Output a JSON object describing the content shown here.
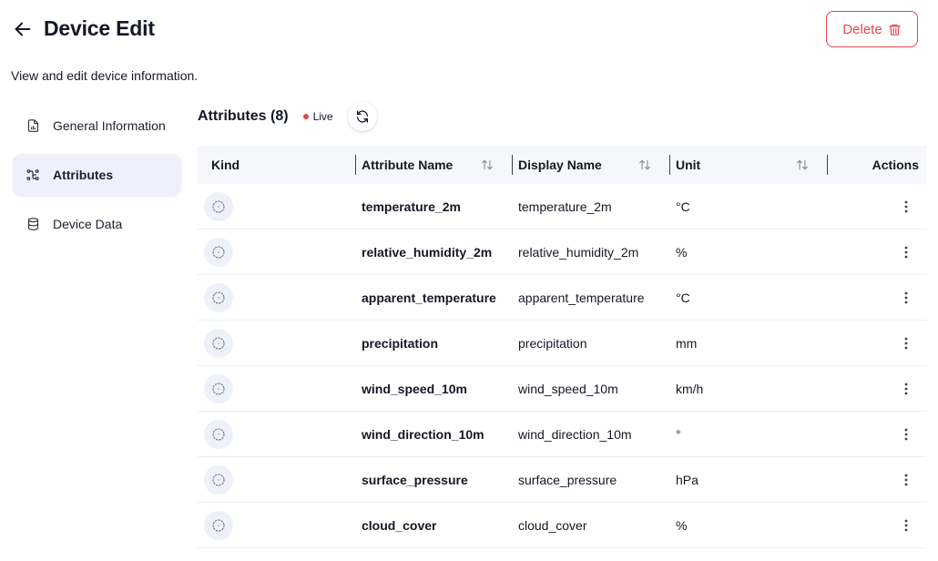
{
  "page": {
    "title": "Device Edit",
    "subtitle": "View and edit device information.",
    "delete_label": "Delete"
  },
  "colors": {
    "danger": "#e5484d",
    "active_nav_bg": "#eff0fb",
    "header_bg": "#f6f7fb"
  },
  "sidebar": {
    "items": [
      {
        "label": "General Information",
        "icon": "file-chart-icon",
        "active": false
      },
      {
        "label": "Attributes",
        "icon": "nodes-icon",
        "active": true
      },
      {
        "label": "Device Data",
        "icon": "database-icon",
        "active": false
      }
    ]
  },
  "section": {
    "title": "Attributes (8)",
    "live_label": "Live"
  },
  "table": {
    "headers": {
      "kind": "Kind",
      "attribute_name": "Attribute Name",
      "display_name": "Display Name",
      "unit": "Unit",
      "actions": "Actions"
    },
    "rows": [
      {
        "attribute_name": "temperature_2m",
        "display_name": "temperature_2m",
        "unit": "°C"
      },
      {
        "attribute_name": "relative_humidity_2m",
        "display_name": "relative_humidity_2m",
        "unit": "%"
      },
      {
        "attribute_name": "apparent_temperature",
        "display_name": "apparent_temperature",
        "unit": "°C"
      },
      {
        "attribute_name": "precipitation",
        "display_name": "precipitation",
        "unit": "mm"
      },
      {
        "attribute_name": "wind_speed_10m",
        "display_name": "wind_speed_10m",
        "unit": "km/h"
      },
      {
        "attribute_name": "wind_direction_10m",
        "display_name": "wind_direction_10m",
        "unit": "°"
      },
      {
        "attribute_name": "surface_pressure",
        "display_name": "surface_pressure",
        "unit": "hPa"
      },
      {
        "attribute_name": "cloud_cover",
        "display_name": "cloud_cover",
        "unit": "%"
      }
    ]
  }
}
